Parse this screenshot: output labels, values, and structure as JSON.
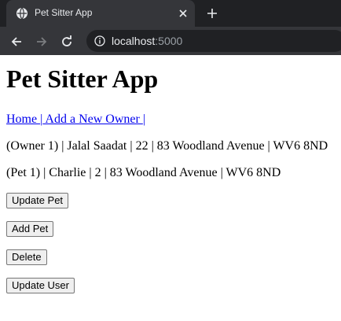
{
  "browser": {
    "tab_title": "Pet Sitter App",
    "url_host": "localhost",
    "url_port": ":5000"
  },
  "page": {
    "heading": "Pet Sitter App",
    "nav": {
      "home": "Home ",
      "sep1": "|",
      "add_owner": " Add a New Owner ",
      "sep2": "|"
    },
    "owner_line": "(Owner 1) | Jalal Saadat | 22 | 83 Woodland Avenue | WV6 8ND",
    "pet_line": "(Pet 1) | Charlie | 2 | 83 Woodland Avenue | WV6 8ND",
    "buttons": {
      "update_pet": "Update Pet",
      "add_pet": "Add Pet",
      "delete": "Delete",
      "update_user": "Update User"
    }
  }
}
